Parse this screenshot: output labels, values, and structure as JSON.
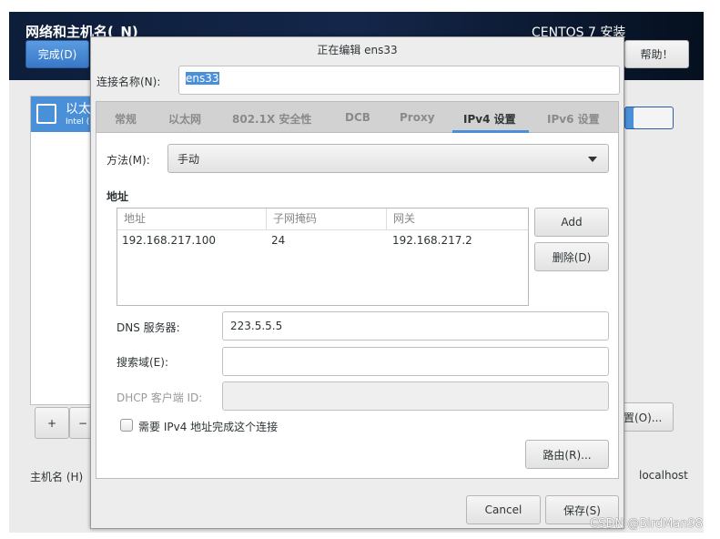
{
  "header": {
    "title": "网络和主机名(_N)",
    "product": "CENTOS 7 安装",
    "done_label": "完成(D)",
    "help_label": "帮助！"
  },
  "background": {
    "selected_item": "以太",
    "selected_sub": "Intel (",
    "add_label": "+",
    "remove_label": "−",
    "configure_label": "置(O)...",
    "hostname_label": "主机名 (H)",
    "hostname_value": "localhost"
  },
  "dialog": {
    "title": "正在编辑 ens33",
    "conn_name_label": "连接名称(N):",
    "conn_name_value": "ens33",
    "tabs": [
      {
        "label": "常规"
      },
      {
        "label": "以太网"
      },
      {
        "label": "802.1X 安全性"
      },
      {
        "label": "DCB"
      },
      {
        "label": "Proxy"
      },
      {
        "label": "IPv4 设置",
        "active": true
      },
      {
        "label": "IPv6 设置"
      }
    ],
    "method_label": "方法(M):",
    "method_value": "手动",
    "address_heading": "地址",
    "columns": [
      "地址",
      "子网掩码",
      "网关"
    ],
    "rows": [
      [
        "192.168.217.100",
        "24",
        "192.168.217.2"
      ]
    ],
    "add_button": "Add",
    "delete_button": "删除(D)",
    "dns_label": "DNS 服务器:",
    "dns_value": "223.5.5.5",
    "search_label": "搜索域(E):",
    "search_value": "",
    "dhcp_label": "DHCP 客户端 ID:",
    "dhcp_value": "",
    "require_label": "需要 IPv4 地址完成这个连接",
    "require_checked": false,
    "routes_button": "路由(R)...",
    "cancel_button": "Cancel",
    "save_button": "保存(S)"
  },
  "watermark": "CSDN @BirdMan98",
  "colors": {
    "accent": "#4a90d9",
    "header": "#14264a"
  }
}
